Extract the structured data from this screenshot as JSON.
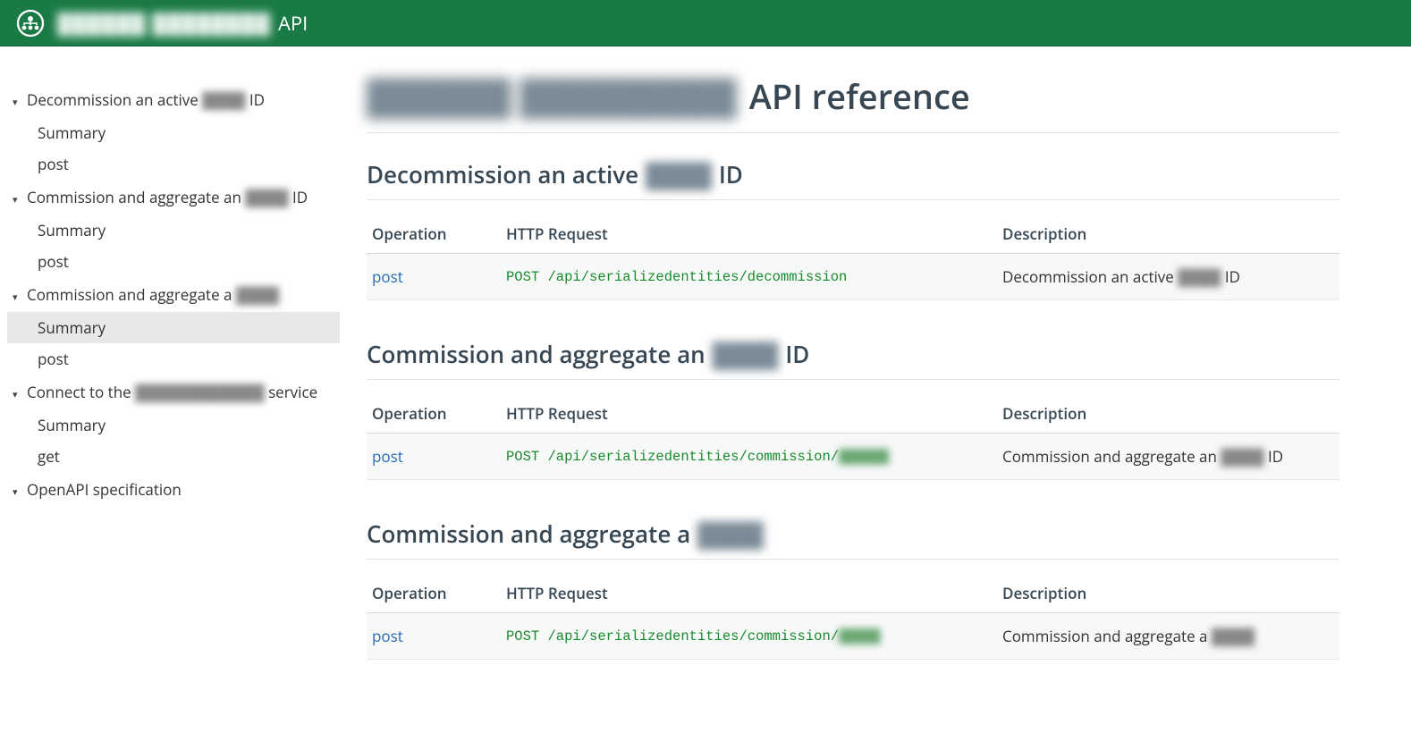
{
  "header": {
    "brand_blur": "██████ ████████",
    "brand_suffix": "API"
  },
  "page": {
    "title_blur": "██████ █████████",
    "title_suffix": "API reference"
  },
  "table_headers": {
    "op": "Operation",
    "req": "HTTP Request",
    "desc": "Description"
  },
  "nav": [
    {
      "title_pre": "Decommission an active ",
      "title_blur": "████",
      "title_post": " ID",
      "children": [
        {
          "label": "Summary",
          "selected": false
        },
        {
          "label": "post",
          "selected": false
        }
      ]
    },
    {
      "title_pre": "Commission and aggregate an ",
      "title_blur": "████",
      "title_post": " ID",
      "children": [
        {
          "label": "Summary",
          "selected": false
        },
        {
          "label": "post",
          "selected": false
        }
      ]
    },
    {
      "title_pre": "Commission and aggregate a ",
      "title_blur": "████",
      "title_post": "",
      "children": [
        {
          "label": "Summary",
          "selected": true
        },
        {
          "label": "post",
          "selected": false
        }
      ]
    },
    {
      "title_pre": "Connect to the ",
      "title_blur": "████████████",
      "title_post": " service",
      "children": [
        {
          "label": "Summary",
          "selected": false
        },
        {
          "label": "get",
          "selected": false
        }
      ]
    },
    {
      "title_pre": "OpenAPI specification",
      "title_blur": "",
      "title_post": "",
      "children": []
    }
  ],
  "sections": [
    {
      "heading_pre": "Decommission an active ",
      "heading_blur": "████",
      "heading_post": " ID",
      "row": {
        "op": "post",
        "req_pre": "POST /api/serializedentities/decommission",
        "req_blur": "",
        "desc_pre": "Decommission an active ",
        "desc_blur": "████",
        "desc_post": " ID"
      }
    },
    {
      "heading_pre": "Commission and aggregate an ",
      "heading_blur": "████",
      "heading_post": " ID",
      "row": {
        "op": "post",
        "req_pre": "POST /api/serializedentities/commission/",
        "req_blur": "██████",
        "desc_pre": "Commission and aggregate an ",
        "desc_blur": "████",
        "desc_post": " ID"
      }
    },
    {
      "heading_pre": "Commission and aggregate a ",
      "heading_blur": "████",
      "heading_post": "",
      "row": {
        "op": "post",
        "req_pre": "POST /api/serializedentities/commission/",
        "req_blur": "█████",
        "desc_pre": "Commission and aggregate a ",
        "desc_blur": "████",
        "desc_post": ""
      }
    }
  ]
}
